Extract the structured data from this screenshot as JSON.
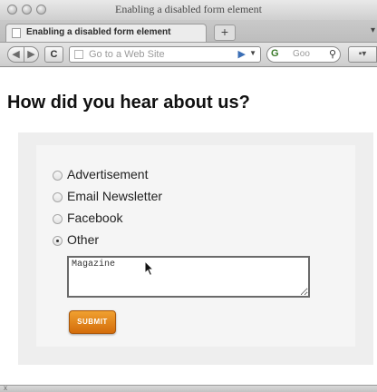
{
  "window": {
    "title": "Enabling a disabled form element"
  },
  "tabs": [
    {
      "label": "Enabling a disabled form element",
      "active": true
    }
  ],
  "tabbar": {
    "new_tab_label": "+"
  },
  "toolbar": {
    "back_icon": "back-arrow-icon",
    "forward_icon": "forward-arrow-icon",
    "reload_label": "C",
    "url_placeholder": "Go to a Web Site",
    "search_engine_label": "G",
    "search_placeholder": "Goo"
  },
  "page": {
    "heading": "How did you hear about us?",
    "options": [
      {
        "label": "Advertisement",
        "checked": false
      },
      {
        "label": "Email Newsletter",
        "checked": false
      },
      {
        "label": "Facebook",
        "checked": false
      },
      {
        "label": "Other",
        "checked": true
      }
    ],
    "other_text_value": "Magazine",
    "submit_label": "SUBMIT"
  },
  "colors": {
    "submit_button": "#e0821b",
    "panel_background": "#eeeeee"
  }
}
